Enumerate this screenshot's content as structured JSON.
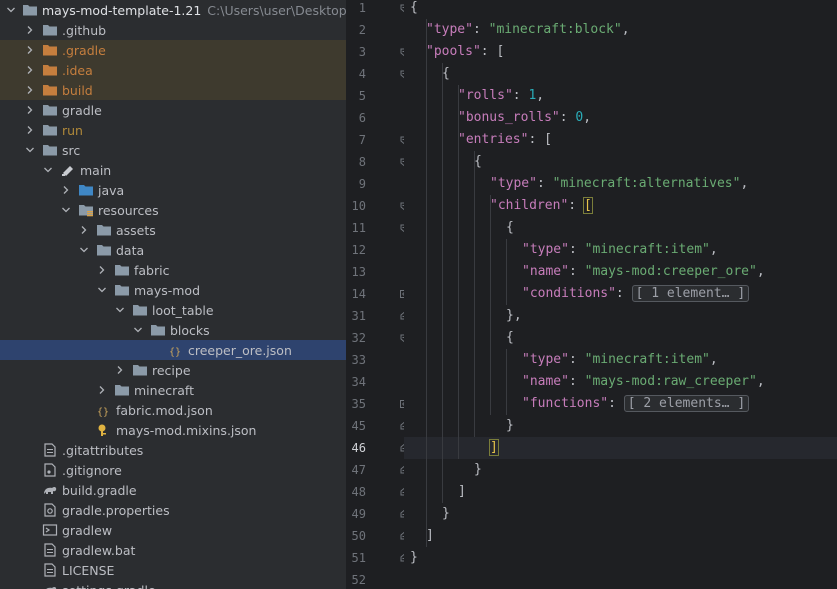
{
  "project": {
    "root_name": "mays-mod-template-1.21",
    "root_path": "C:\\Users\\user\\Desktop\\m",
    "items": [
      {
        "label": ".github",
        "depth": 1,
        "chevron": "right",
        "icon": "folder-icon"
      },
      {
        "label": ".gradle",
        "depth": 1,
        "chevron": "right",
        "icon": "folder-orange-icon",
        "state": "ignored"
      },
      {
        "label": ".idea",
        "depth": 1,
        "chevron": "right",
        "icon": "folder-orange-icon",
        "state": "ignored"
      },
      {
        "label": "build",
        "depth": 1,
        "chevron": "right",
        "icon": "folder-orange-icon",
        "state": "ignored"
      },
      {
        "label": "gradle",
        "depth": 1,
        "chevron": "right",
        "icon": "folder-icon"
      },
      {
        "label": "run",
        "depth": 1,
        "chevron": "right",
        "icon": "folder-icon",
        "state": "olive"
      },
      {
        "label": "src",
        "depth": 1,
        "chevron": "down",
        "icon": "folder-icon"
      },
      {
        "label": "main",
        "depth": 2,
        "chevron": "down",
        "icon": "module-icon"
      },
      {
        "label": "java",
        "depth": 3,
        "chevron": "right",
        "icon": "source-folder-icon"
      },
      {
        "label": "resources",
        "depth": 3,
        "chevron": "down",
        "icon": "resources-folder-icon"
      },
      {
        "label": "assets",
        "depth": 4,
        "chevron": "right",
        "icon": "folder-icon"
      },
      {
        "label": "data",
        "depth": 4,
        "chevron": "down",
        "icon": "folder-icon"
      },
      {
        "label": "fabric",
        "depth": 5,
        "chevron": "right",
        "icon": "folder-icon"
      },
      {
        "label": "mays-mod",
        "depth": 5,
        "chevron": "down",
        "icon": "folder-icon"
      },
      {
        "label": "loot_table",
        "depth": 6,
        "chevron": "down",
        "icon": "folder-icon"
      },
      {
        "label": "blocks",
        "depth": 7,
        "chevron": "down",
        "icon": "folder-icon"
      },
      {
        "label": "creeper_ore.json",
        "depth": 8,
        "chevron": "none",
        "icon": "json-file-icon",
        "state": "selected"
      },
      {
        "label": "recipe",
        "depth": 6,
        "chevron": "right",
        "icon": "folder-icon"
      },
      {
        "label": "minecraft",
        "depth": 5,
        "chevron": "right",
        "icon": "folder-icon"
      },
      {
        "label": "fabric.mod.json",
        "depth": 4,
        "chevron": "none",
        "icon": "json-file-icon"
      },
      {
        "label": "mays-mod.mixins.json",
        "depth": 4,
        "chevron": "none",
        "icon": "mixins-file-icon"
      },
      {
        "label": ".gitattributes",
        "depth": 1,
        "chevron": "none",
        "icon": "text-file-icon"
      },
      {
        "label": ".gitignore",
        "depth": 1,
        "chevron": "none",
        "icon": "gitignore-file-icon"
      },
      {
        "label": "build.gradle",
        "depth": 1,
        "chevron": "none",
        "icon": "gradle-file-icon"
      },
      {
        "label": "gradle.properties",
        "depth": 1,
        "chevron": "none",
        "icon": "properties-file-icon"
      },
      {
        "label": "gradlew",
        "depth": 1,
        "chevron": "none",
        "icon": "shell-file-icon"
      },
      {
        "label": "gradlew.bat",
        "depth": 1,
        "chevron": "none",
        "icon": "text-file-icon"
      },
      {
        "label": "LICENSE",
        "depth": 1,
        "chevron": "none",
        "icon": "text-file-icon"
      },
      {
        "label": "settings.gradle",
        "depth": 1,
        "chevron": "none",
        "icon": "gradle-file-icon"
      }
    ]
  },
  "editor": {
    "current_line": "46",
    "lines": [
      {
        "num": "1",
        "fold": "open",
        "indent": 0,
        "tokens": [
          {
            "t": "{",
            "c": "p"
          }
        ]
      },
      {
        "num": "2",
        "fold": "",
        "indent": 1,
        "tokens": [
          {
            "t": "\"type\"",
            "c": "k"
          },
          {
            "t": ": ",
            "c": "p"
          },
          {
            "t": "\"minecraft:block\"",
            "c": "s"
          },
          {
            "t": ",",
            "c": "p"
          }
        ]
      },
      {
        "num": "3",
        "fold": "open",
        "indent": 1,
        "tokens": [
          {
            "t": "\"pools\"",
            "c": "k"
          },
          {
            "t": ": [",
            "c": "p"
          }
        ]
      },
      {
        "num": "4",
        "fold": "open",
        "indent": 2,
        "tokens": [
          {
            "t": "{",
            "c": "p"
          }
        ]
      },
      {
        "num": "5",
        "fold": "",
        "indent": 3,
        "tokens": [
          {
            "t": "\"rolls\"",
            "c": "k"
          },
          {
            "t": ": ",
            "c": "p"
          },
          {
            "t": "1",
            "c": "n"
          },
          {
            "t": ",",
            "c": "p"
          }
        ]
      },
      {
        "num": "6",
        "fold": "",
        "indent": 3,
        "tokens": [
          {
            "t": "\"bonus_rolls\"",
            "c": "k"
          },
          {
            "t": ": ",
            "c": "p"
          },
          {
            "t": "0",
            "c": "n"
          },
          {
            "t": ",",
            "c": "p"
          }
        ]
      },
      {
        "num": "7",
        "fold": "open",
        "indent": 3,
        "tokens": [
          {
            "t": "\"entries\"",
            "c": "k"
          },
          {
            "t": ": [",
            "c": "p"
          }
        ]
      },
      {
        "num": "8",
        "fold": "open",
        "indent": 4,
        "tokens": [
          {
            "t": "{",
            "c": "p"
          }
        ]
      },
      {
        "num": "9",
        "fold": "",
        "indent": 5,
        "tokens": [
          {
            "t": "\"type\"",
            "c": "k"
          },
          {
            "t": ": ",
            "c": "p"
          },
          {
            "t": "\"minecraft:alternatives\"",
            "c": "s"
          },
          {
            "t": ",",
            "c": "p"
          }
        ]
      },
      {
        "num": "10",
        "fold": "open",
        "indent": 5,
        "tokens": [
          {
            "t": "\"children\"",
            "c": "k"
          },
          {
            "t": ": ",
            "c": "p"
          },
          {
            "t": "[",
            "c": "hl"
          }
        ]
      },
      {
        "num": "11",
        "fold": "open",
        "indent": 6,
        "tokens": [
          {
            "t": "{",
            "c": "p"
          }
        ]
      },
      {
        "num": "12",
        "fold": "",
        "indent": 7,
        "tokens": [
          {
            "t": "\"type\"",
            "c": "k"
          },
          {
            "t": ": ",
            "c": "p"
          },
          {
            "t": "\"minecraft:item\"",
            "c": "s"
          },
          {
            "t": ",",
            "c": "p"
          }
        ]
      },
      {
        "num": "13",
        "fold": "",
        "indent": 7,
        "tokens": [
          {
            "t": "\"name\"",
            "c": "k"
          },
          {
            "t": ": ",
            "c": "p"
          },
          {
            "t": "\"mays-mod:creeper_ore\"",
            "c": "s"
          },
          {
            "t": ",",
            "c": "p"
          }
        ]
      },
      {
        "num": "14",
        "fold": "closed",
        "indent": 7,
        "tokens": [
          {
            "t": "\"conditions\"",
            "c": "k"
          },
          {
            "t": ": ",
            "c": "p"
          },
          {
            "t": "[ 1 element… ]",
            "c": "pill"
          }
        ]
      },
      {
        "num": "31",
        "fold": "end",
        "indent": 6,
        "tokens": [
          {
            "t": "},",
            "c": "p"
          }
        ]
      },
      {
        "num": "32",
        "fold": "open",
        "indent": 6,
        "tokens": [
          {
            "t": "{",
            "c": "p"
          }
        ]
      },
      {
        "num": "33",
        "fold": "",
        "indent": 7,
        "tokens": [
          {
            "t": "\"type\"",
            "c": "k"
          },
          {
            "t": ": ",
            "c": "p"
          },
          {
            "t": "\"minecraft:item\"",
            "c": "s"
          },
          {
            "t": ",",
            "c": "p"
          }
        ]
      },
      {
        "num": "34",
        "fold": "",
        "indent": 7,
        "tokens": [
          {
            "t": "\"name\"",
            "c": "k"
          },
          {
            "t": ": ",
            "c": "p"
          },
          {
            "t": "\"mays-mod:raw_creeper\"",
            "c": "s"
          },
          {
            "t": ",",
            "c": "p"
          }
        ]
      },
      {
        "num": "35",
        "fold": "closed",
        "indent": 7,
        "tokens": [
          {
            "t": "\"functions\"",
            "c": "k"
          },
          {
            "t": ": ",
            "c": "p"
          },
          {
            "t": "[ 2 elements… ]",
            "c": "pill"
          }
        ]
      },
      {
        "num": "45",
        "fold": "end",
        "indent": 6,
        "tokens": [
          {
            "t": "}",
            "c": "p"
          }
        ]
      },
      {
        "num": "46",
        "fold": "end",
        "indent": 5,
        "tokens": [
          {
            "t": "]",
            "c": "hl"
          }
        ]
      },
      {
        "num": "47",
        "fold": "end",
        "indent": 4,
        "tokens": [
          {
            "t": "}",
            "c": "p"
          }
        ]
      },
      {
        "num": "48",
        "fold": "end",
        "indent": 3,
        "tokens": [
          {
            "t": "]",
            "c": "p"
          }
        ]
      },
      {
        "num": "49",
        "fold": "end",
        "indent": 2,
        "tokens": [
          {
            "t": "}",
            "c": "p"
          }
        ]
      },
      {
        "num": "50",
        "fold": "end",
        "indent": 1,
        "tokens": [
          {
            "t": "]",
            "c": "p"
          }
        ]
      },
      {
        "num": "51",
        "fold": "end",
        "indent": 0,
        "tokens": [
          {
            "t": "}",
            "c": "p"
          }
        ]
      },
      {
        "num": "52",
        "fold": "",
        "indent": 0,
        "tokens": []
      }
    ]
  },
  "colors": {
    "key": "#c77dbb",
    "string": "#6aab73",
    "number": "#2aacb8",
    "selection": "#2e436e",
    "ignored_bg": "#3e3a2e"
  }
}
